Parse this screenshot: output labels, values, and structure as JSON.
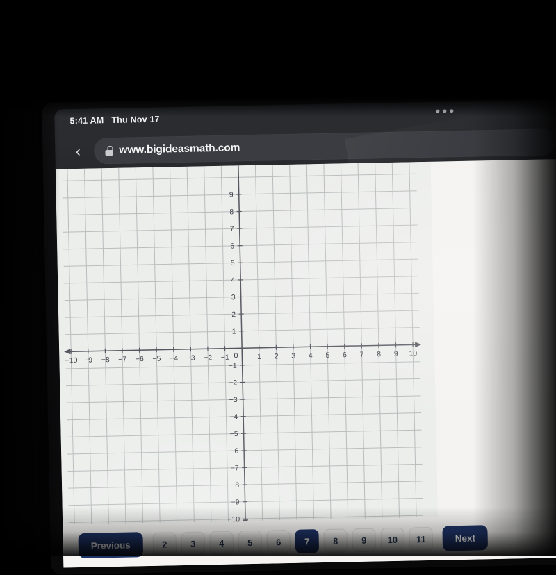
{
  "status_bar": {
    "time": "5:41 AM",
    "date": "Thu Nov 17",
    "more_icon": "more-dots-icon"
  },
  "browser": {
    "back_icon": "chevron-left-icon",
    "lock_icon": "lock-icon",
    "url": "www.bigideasmath.com"
  },
  "pagination": {
    "previous_label": "Previous",
    "next_label": "Next",
    "pages": [
      "2",
      "3",
      "4",
      "5",
      "6",
      "7",
      "8",
      "9",
      "10",
      "11"
    ],
    "active_page": "7",
    "accent_color": "#1e3365",
    "inactive_text_color": "#2d3b54"
  },
  "chart_data": {
    "type": "scatter",
    "title": "",
    "xlabel": "",
    "ylabel": "",
    "xlim": [
      -10,
      10
    ],
    "ylim": [
      -10,
      10
    ],
    "xticks": [
      -10,
      -9,
      -8,
      -7,
      -6,
      -5,
      -4,
      -3,
      -2,
      -1,
      0,
      1,
      2,
      3,
      4,
      5,
      6,
      7,
      8,
      9,
      10
    ],
    "yticks": [
      9,
      8,
      7,
      6,
      5,
      4,
      3,
      2,
      1,
      0,
      -1,
      -2,
      -3,
      -4,
      -5,
      -6,
      -7,
      -8,
      -9,
      -10
    ],
    "xtick_labels": [
      "-10",
      "-9",
      "-8",
      "-7",
      "-6",
      "-5",
      "-4",
      "-3",
      "-2",
      "-1",
      "0",
      "1",
      "2",
      "3",
      "4",
      "5",
      "6",
      "7",
      "8",
      "9",
      "10"
    ],
    "ytick_labels": [
      "9",
      "8",
      "7",
      "6",
      "5",
      "4",
      "3",
      "2",
      "1",
      "0",
      "-1",
      "-2",
      "-3",
      "-4",
      "-5",
      "-6",
      "-7",
      "-8",
      "-9",
      "-10"
    ],
    "grid": true,
    "grid_color": "#b9bcbd",
    "axis_color": "#55565f",
    "legend": null,
    "series": [],
    "values": [],
    "notes": "Empty blank coordinate plane; x-axis arrowheads both ends, y-axis arrowhead at bottom; top of plane clipped above y=9 by browser chrome."
  }
}
